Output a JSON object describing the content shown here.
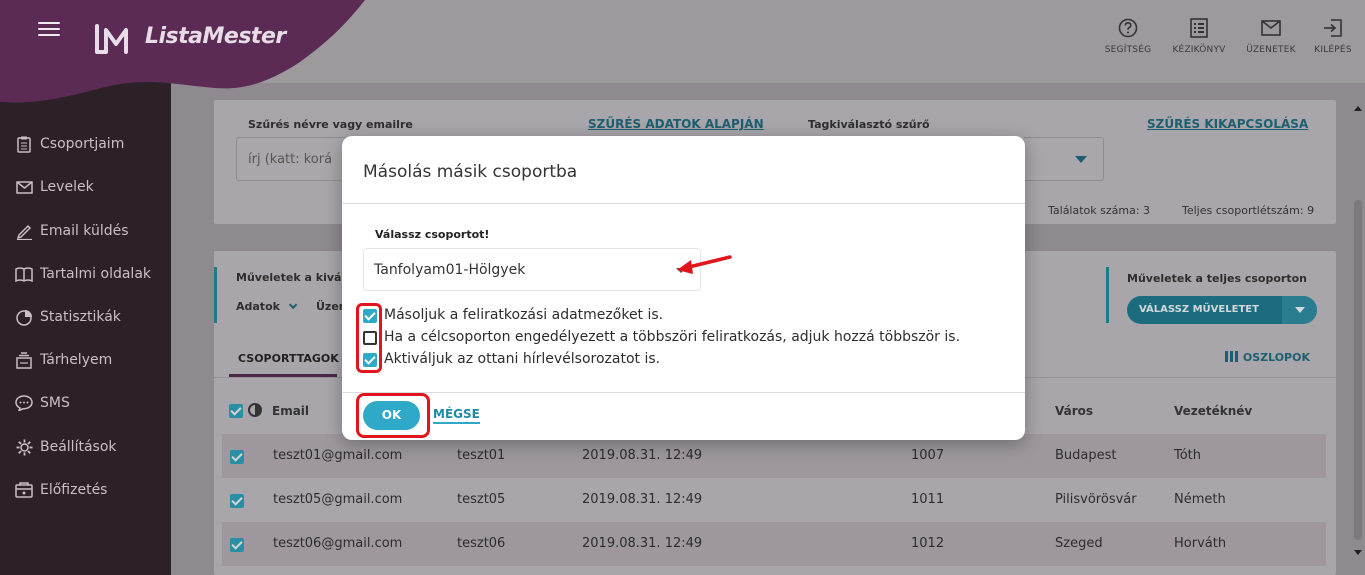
{
  "app": {
    "name": "ListaMester"
  },
  "header_actions": [
    {
      "label": "SEGÍTSÉG",
      "icon": "help-icon"
    },
    {
      "label": "KÉZIKÖNYV",
      "icon": "manual-icon"
    },
    {
      "label": "ÜZENETEK",
      "icon": "mail-icon"
    },
    {
      "label": "KILÉPÉS",
      "icon": "logout-icon"
    }
  ],
  "sidebar": {
    "items": [
      {
        "label": "Csoportjaim",
        "icon": "clipboard-icon"
      },
      {
        "label": "Levelek",
        "icon": "envelope-icon"
      },
      {
        "label": "Email küldés",
        "icon": "pencil-icon"
      },
      {
        "label": "Tartalmi oldalak",
        "icon": "book-icon"
      },
      {
        "label": "Statisztikák",
        "icon": "pie-chart-icon"
      },
      {
        "label": "Tárhelyem",
        "icon": "storage-icon"
      },
      {
        "label": "SMS",
        "icon": "sms-icon"
      },
      {
        "label": "Beállítások",
        "icon": "gear-icon"
      },
      {
        "label": "Előfizetés",
        "icon": "subscription-icon"
      }
    ]
  },
  "filter": {
    "name_label": "Szűrés névre vagy emailre",
    "name_placeholder": "írj (katt: korá",
    "by_data_link": "SZŰRÉS ADATOK ALAPJÁN",
    "tag_label": "Tagkiválasztó szűrő",
    "disable_link": "SZŰRÉS KIKAPCSOLÁSA",
    "results": "Találatok száma: 3",
    "total": "Teljes csoportlétszám: 9"
  },
  "actions": {
    "selected_label": "Műveletek a kivál",
    "data_menu": "Adatok",
    "other_menu": "Üzen",
    "group_label": "Műveletek a teljes csoporton",
    "choose_button": "VÁLASSZ MŰVELETET"
  },
  "tabs": {
    "members": "CSOPORTTAGOK",
    "columns": "OSZLOPOK"
  },
  "table": {
    "headers": {
      "email": "Email",
      "city": "Város",
      "lastname": "Vezetéknév"
    },
    "rows": [
      {
        "email": "teszt01@gmail.com",
        "user": "teszt01",
        "date": "2019.08.31. 12:49",
        "zip": "1007",
        "city": "Budapest",
        "lastname": "Tóth"
      },
      {
        "email": "teszt05@gmail.com",
        "user": "teszt05",
        "date": "2019.08.31. 12:49",
        "zip": "1011",
        "city": "Pilisvörösvár",
        "lastname": "Németh"
      },
      {
        "email": "teszt06@gmail.com",
        "user": "teszt06",
        "date": "2019.08.31. 12:49",
        "zip": "1012",
        "city": "Szeged",
        "lastname": "Horváth"
      }
    ]
  },
  "modal": {
    "title": "Másolás másik csoportba",
    "select_label": "Válassz csoportot!",
    "selected_group": "Tanfolyam01-Hölgyek",
    "options": [
      {
        "label": "Másoljuk a feliratkozási adatmezőket is.",
        "checked": true
      },
      {
        "label": "Ha a célcsoporton engedélyezett a többszöri feliratkozás, adjuk hozzá többször is.",
        "checked": false
      },
      {
        "label": "Aktiváljuk az ottani hírlevélsorozatot is.",
        "checked": true
      }
    ],
    "ok": "OK",
    "cancel": "MÉGSE"
  },
  "colors": {
    "accent": "#2eaac8",
    "sidebar": "#2b2126",
    "brand": "#5b2a55",
    "highlight": "#e0151d"
  }
}
